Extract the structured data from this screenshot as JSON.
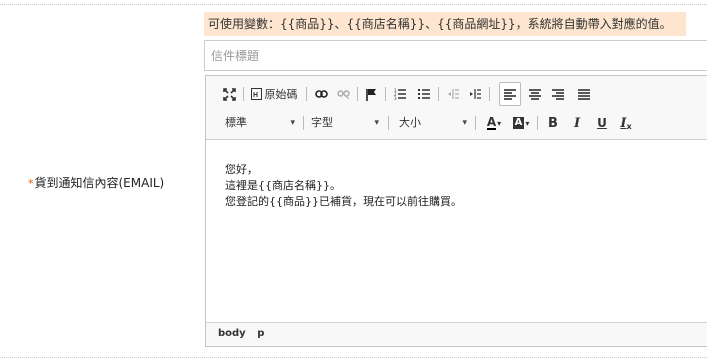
{
  "field": {
    "required_mark": "*",
    "label": "貨到通知信內容(EMAIL)"
  },
  "hint": {
    "text": "可使用變數：{{商品}}、{{商店名稱}}、{{商品網址}}，系統將自動帶入對應的值。"
  },
  "subject": {
    "placeholder": "信件標題",
    "value": ""
  },
  "toolbar": {
    "row1": [
      {
        "name": "maximize-icon"
      },
      {
        "name": "source-button",
        "label": "原始碼"
      },
      {
        "name": "link-icon"
      },
      {
        "name": "unlink-icon"
      },
      {
        "name": "anchor-flag-icon"
      },
      {
        "name": "numbered-list-icon"
      },
      {
        "name": "bulleted-list-icon"
      },
      {
        "name": "outdent-icon"
      },
      {
        "name": "indent-icon"
      },
      {
        "name": "align-left-icon",
        "active": true
      },
      {
        "name": "align-center-icon"
      },
      {
        "name": "align-right-icon"
      },
      {
        "name": "align-justify-icon"
      }
    ],
    "format_combo": "標準",
    "font_combo": "字型",
    "size_combo": "大小",
    "text_color_label": "A",
    "bg_color_label": "A",
    "bold_label": "B",
    "italic_label": "I",
    "underline_label": "U",
    "remove_format_label": "I",
    "remove_format_sub": "x"
  },
  "content": {
    "lines": [
      "您好，",
      "這裡是{{商店名稱}}。",
      "您登記的{{商品}}已補貨，現在可以前往購買。"
    ]
  },
  "pathbar": {
    "items": [
      "body",
      "p"
    ]
  }
}
